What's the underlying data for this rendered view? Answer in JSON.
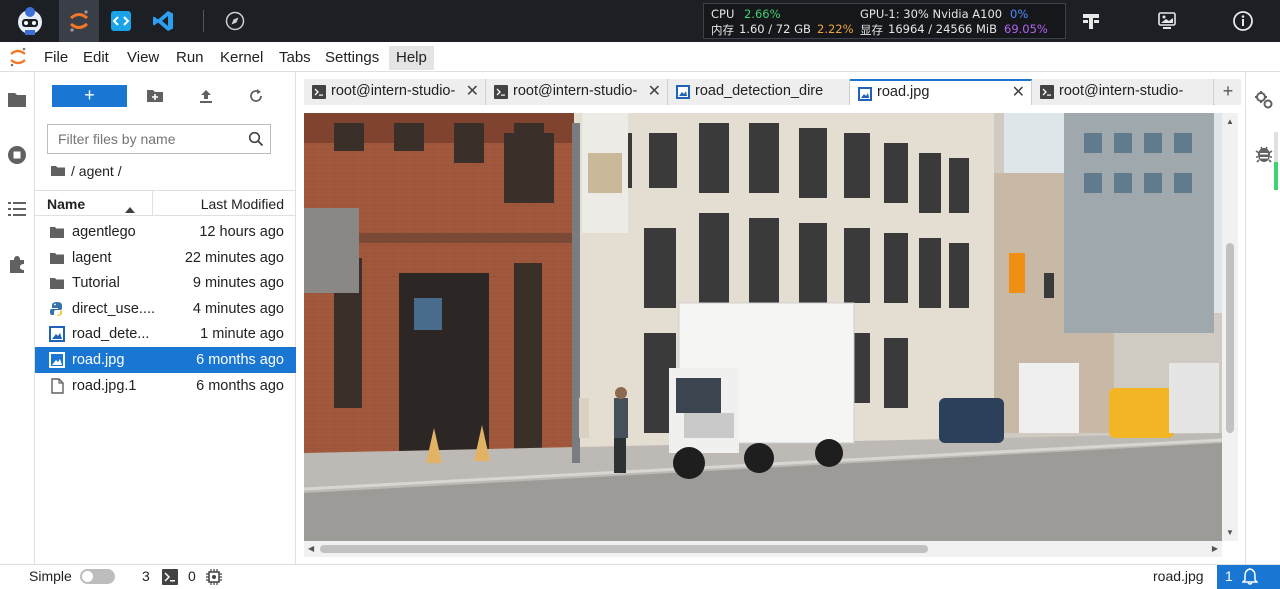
{
  "topbar": {
    "apps": [
      "intern-studio-logo-icon",
      "jupyter-icon",
      "code-editor-icon",
      "vscode-icon",
      "compass-icon"
    ],
    "cpu_label": "CPU",
    "cpu_value": "2.66%",
    "mem_label": "内存",
    "mem_value": "1.60 / 72 GB",
    "mem_pct": "2.22%",
    "gpu_label": "GPU-1: 30% Nvidia A100",
    "gpu_value": "0%",
    "vram_label": "显存",
    "vram_value": "16964 / 24566 MiB",
    "vram_pct": "69.05%",
    "colors": {
      "ok": "#3fd26f",
      "warn": "#f0a63a",
      "gpu": "#4f8dff",
      "vram": "#b463f3"
    }
  },
  "menubar": {
    "items": [
      "File",
      "Edit",
      "View",
      "Run",
      "Kernel",
      "Tabs",
      "Settings",
      "Help"
    ]
  },
  "filebrowser": {
    "new_label": "+",
    "filter_placeholder": "Filter files by name",
    "breadcrumb": "/ agent /",
    "col_name": "Name",
    "col_modified": "Last Modified",
    "files": [
      {
        "name": "agentlego",
        "modified": "12 hours ago",
        "type": "folder"
      },
      {
        "name": "lagent",
        "modified": "22 minutes ago",
        "type": "folder"
      },
      {
        "name": "Tutorial",
        "modified": "9 minutes ago",
        "type": "folder"
      },
      {
        "name": "direct_use....",
        "modified": "4 minutes ago",
        "type": "python"
      },
      {
        "name": "road_dete...",
        "modified": "1 minute ago",
        "type": "image"
      },
      {
        "name": "road.jpg",
        "modified": "6 months ago",
        "type": "image",
        "selected": true
      },
      {
        "name": "road.jpg.1",
        "modified": "6 months ago",
        "type": "file"
      }
    ]
  },
  "tabs": [
    {
      "label": "root@intern-studio-",
      "type": "terminal"
    },
    {
      "label": "root@intern-studio-",
      "type": "terminal"
    },
    {
      "label": "road_detection_dire",
      "type": "image"
    },
    {
      "label": "road.jpg",
      "type": "image",
      "active": true
    },
    {
      "label": "root@intern-studio-",
      "type": "terminal"
    }
  ],
  "statusbar": {
    "mode": "Simple",
    "terminals": "3",
    "kernels": "0",
    "filename": "road.jpg",
    "notifications": "1"
  }
}
